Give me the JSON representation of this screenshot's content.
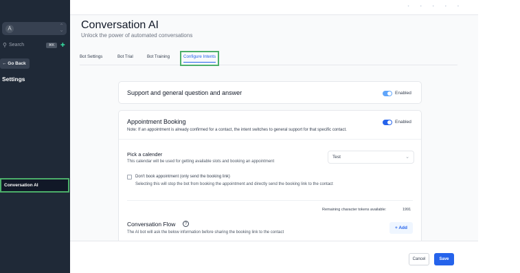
{
  "sidebar": {
    "account_initial": "A",
    "switcher_icon": "chevron-updown-icon",
    "search": {
      "placeholder": "Search",
      "shortcut": "⌘K"
    },
    "go_back": "← Go Back",
    "section_title": "Settings",
    "active_item": "Conversation AI"
  },
  "header": {
    "title": "Conversation AI",
    "subtitle": "Unlock the power of automated conversations"
  },
  "tabs": [
    "Bot Settings",
    "Bot Trial",
    "Bot Training",
    "Configure Intents"
  ],
  "active_tab": "Configure Intents",
  "intents": {
    "support": {
      "title": "Support and general question and answer",
      "status": "Enabled"
    },
    "appointment": {
      "title": "Appointment Booking",
      "status": "Enabled",
      "note": "Note: If an appointment is already confirmed for a contact, the intent switches to general support for that specific contact.",
      "calendar_label": "Pick a calender",
      "calendar_help": "This calendar will be used for getting available slots and booking an appointment",
      "calendar_value": "Test",
      "dont_book_label": "Don't book appointment (only send the booking link)",
      "dont_book_help": "Selecting this will stop the bot from booking the appointment and directly send the booking link to the contact",
      "remaining_tokens_label": "Remaining character tokens available:",
      "remaining_tokens_value": "1991",
      "flow_title": "Conversation Flow",
      "flow_help": "The AI bot will ask the below information before sharing the booking link to the contact",
      "add_label": "+ Add"
    }
  },
  "footer": {
    "cancel": "Cancel",
    "save": "Save"
  },
  "colors": {
    "accent": "#2563eb",
    "sidebar": "#1f2937",
    "highlight": "#4caf6a"
  }
}
